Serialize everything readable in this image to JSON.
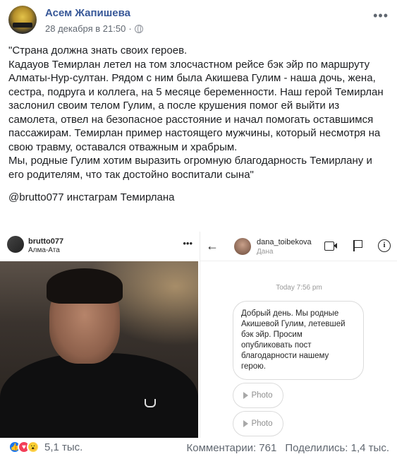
{
  "post": {
    "author": "Асем Жапишева",
    "date": "28 декабря в 21:50",
    "dot": "·",
    "more": "•••",
    "text": "\"Страна должна знать своих героев.\nКадауов Темирлан летел на том злосчастном рейсе бэк эйр по маршруту Алматы-Нур-султан. Рядом с ним была Акишева Гулим - наша дочь, жена, сестра, подруга и коллега, на 5 месяце беременности. Наш герой Темирлан заслонил своим телом Гулим, а после крушения помог ей выйти из самолета, отвел на безопасное расстояние и начал помогать оставшимся пассажирам. Темирлан пример настоящего мужчины, который несмотря на свою травму, оставался отважным и храбрым.\nМы, родные Гулим хотим выразить огромную благодарность Темирлану и его родителям, что так достойно воспитали сына\"",
    "tag": "@brutto077 инстаграм Темирлана"
  },
  "left_image": {
    "username": "brutto077",
    "location": "Алма-Ата",
    "more": "•••"
  },
  "right_image": {
    "back": "←",
    "username": "dana_toibekova",
    "subtitle": "Дана",
    "info": "i",
    "time": "Today 7:56 pm",
    "message": "Добрый день. Мы родные Акишевой Гулим, летевшей бэк эйр. Просим опубликовать пост благодарности нашему герою.",
    "photo1": "Photo",
    "photo2": "Photo"
  },
  "footer": {
    "reaction_like": "👍",
    "reaction_love": "♥",
    "reaction_wow": "😮",
    "reactions_count": "5,1 тыс.",
    "comments": "Комментарии: 761",
    "shares": "Поделились: 1,4 тыс."
  },
  "colors": {
    "author_link": "#385898",
    "secondary_text": "#606770",
    "like_blue": "#1877f2",
    "love_red": "#f33e58"
  }
}
